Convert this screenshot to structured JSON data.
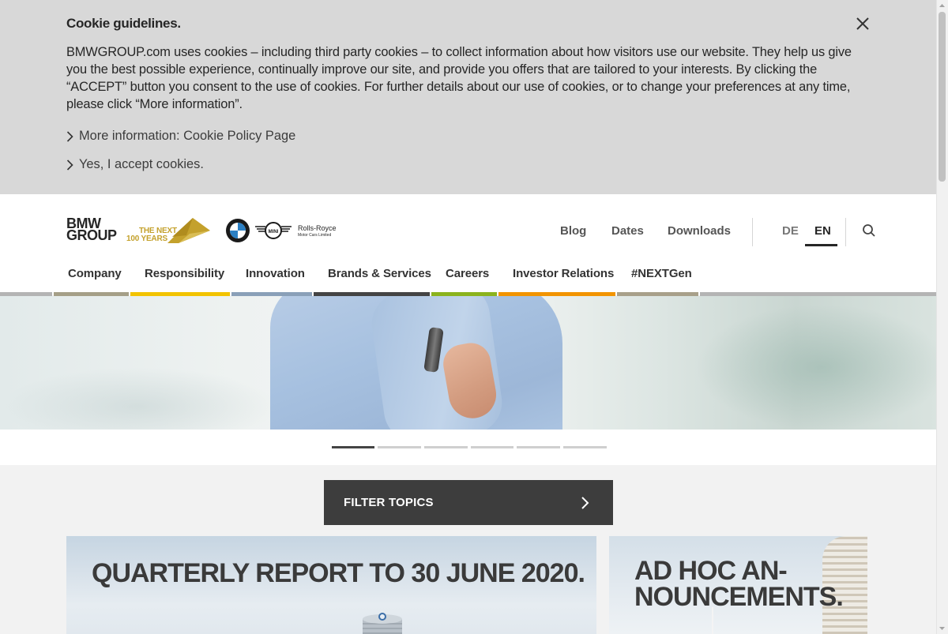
{
  "cookie": {
    "title": "Cookie guidelines.",
    "text": "BMWGROUP.com uses cookies – including third party cookies – to collect information about how visitors use our website. They help us give you the best possible experience, continually improve our site, and provide you offers that are tailored to your interests. By clicking the “ACCEPT” button you consent to the use of cookies. For further details about our use of cookies, or to change your preferences at any time, please click “More information”.",
    "more_info": "More information: Cookie Policy Page",
    "accept": "Yes, I accept cookies."
  },
  "header": {
    "logo_line1": "BMW",
    "logo_line2": "GROUP",
    "next_line1": "THE NEXT",
    "next_line2": "100 YEARS",
    "rr_line1": "Rolls-Royce",
    "rr_line2": "Motor Cars Limited",
    "util_nav": [
      "Blog",
      "Dates",
      "Downloads"
    ],
    "lang_de": "DE",
    "lang_en": "EN",
    "main_nav": [
      "Company",
      "Responsibility",
      "Innovation",
      "Brands & Services",
      "Careers",
      "Investor Relations",
      "#NEXTGen"
    ],
    "nav_colors": [
      "#a59f87",
      "#f2c300",
      "#8aa0b8",
      "#444444",
      "#8bb31d",
      "#f29400",
      "#a8a08a",
      "#b4b4b4"
    ],
    "gold": "#c4a12c"
  },
  "slider": {
    "count": 6,
    "active_index": 0
  },
  "filter": {
    "label": "FILTER TOPICS"
  },
  "teasers": {
    "quarterly": "QUARTERLY REPORT TO 30 JUNE 2020.",
    "adhoc_line1": "AD HOC AN-",
    "adhoc_line2": "NOUNCEMENTS."
  }
}
